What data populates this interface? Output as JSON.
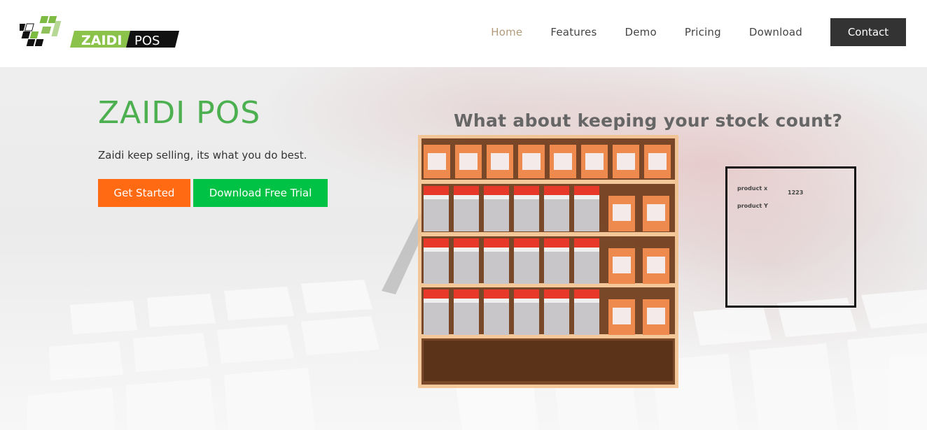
{
  "brand": {
    "name": "ZAIDI",
    "suffix": "POS",
    "logo_icon": "zaidi-grid-logo"
  },
  "nav": {
    "items": [
      {
        "label": "Home",
        "active": true
      },
      {
        "label": "Features",
        "active": false
      },
      {
        "label": "Demo",
        "active": false
      },
      {
        "label": "Pricing",
        "active": false
      },
      {
        "label": "Download",
        "active": false
      }
    ],
    "contact_label": "Contact"
  },
  "hero": {
    "title": "ZAIDI POS",
    "subtitle": "Zaidi keep selling, its what you do best.",
    "get_started_label": "Get Started",
    "download_trial_label": "Download Free Trial"
  },
  "stock": {
    "heading": "What about keeping your stock count?",
    "rows": [
      {
        "product": "product x",
        "count": "1223"
      },
      {
        "product": "product Y",
        "count": ""
      }
    ]
  },
  "colors": {
    "accent_green": "#4caf50",
    "orange": "#ff6a13",
    "green_button": "#00c244",
    "nav_active": "#b29a7a",
    "contact_bg": "#333333"
  }
}
